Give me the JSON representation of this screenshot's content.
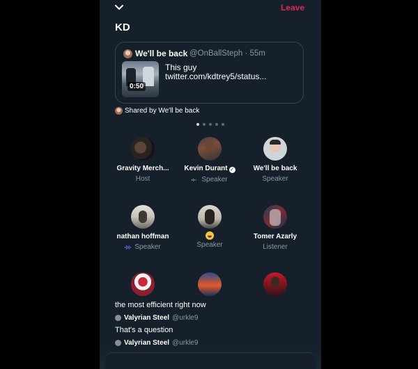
{
  "space": {
    "title": "KD",
    "leave_label": "Leave"
  },
  "shared_tweet": {
    "author_name": "We'll be back",
    "author_handle": "@OnBallSteph · 55m",
    "text_line1": "This guy",
    "text_line2": "twitter.com/kdtrey5/status...",
    "video_duration": "0:50"
  },
  "shared_by": "Shared by We'll be back",
  "carousel": {
    "count": 5,
    "active": 0
  },
  "participants": [
    {
      "name": "Gravity Merch...",
      "role": "Host",
      "verified": false,
      "speaking": false
    },
    {
      "name": "Kevin Durant",
      "role": "Speaker",
      "verified": true,
      "speaking": true
    },
    {
      "name": "We'll be back",
      "role": "Speaker",
      "verified": false,
      "speaking": false
    },
    {
      "name": "nathan hoffman",
      "role": "Speaker",
      "verified": false,
      "speaking": true
    },
    {
      "name": "",
      "role": "Speaker",
      "emoji": "smiling-face",
      "verified": false,
      "speaking": false
    },
    {
      "name": "Tomer Azarly",
      "role": "Listener",
      "verified": false,
      "speaking": false
    }
  ],
  "comments": [
    {
      "text": "the most efficient right now",
      "user": "Valyrian Steel",
      "handle": "@urkle9"
    },
    {
      "text": "That's a question",
      "user": "Valyrian Steel",
      "handle": "@urkle9"
    }
  ],
  "colors": {
    "background": "#15202b",
    "leave": "#e0245e",
    "muted": "#8899a6",
    "speaking_wave": "#7c68f0"
  }
}
